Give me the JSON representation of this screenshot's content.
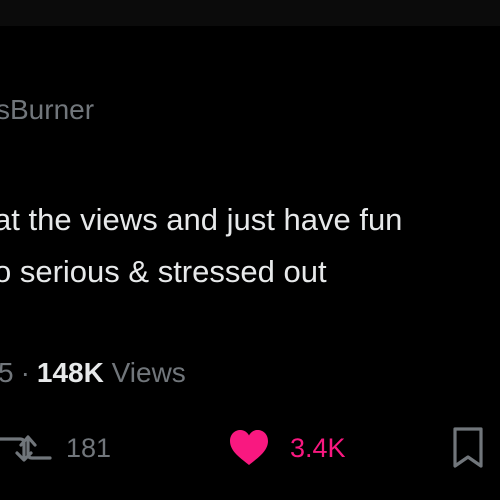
{
  "tweet": {
    "username_fragment": "sBurner",
    "text_lines": [
      "at the views and just have fun",
      "o serious & stressed out"
    ]
  },
  "meta": {
    "date_fragment": "5",
    "separator": "·",
    "views_count": "148K",
    "views_label": "Views"
  },
  "actions": {
    "retweet": {
      "icon": "retweet-icon",
      "count": "181"
    },
    "like": {
      "icon": "heart-icon",
      "count": "3.4K",
      "active": true,
      "color": "#f91880"
    },
    "bookmark": {
      "icon": "bookmark-icon"
    }
  },
  "colors": {
    "background": "#000000",
    "text_primary": "#e7e9ea",
    "text_secondary": "#71767b",
    "like_active": "#f91880"
  }
}
